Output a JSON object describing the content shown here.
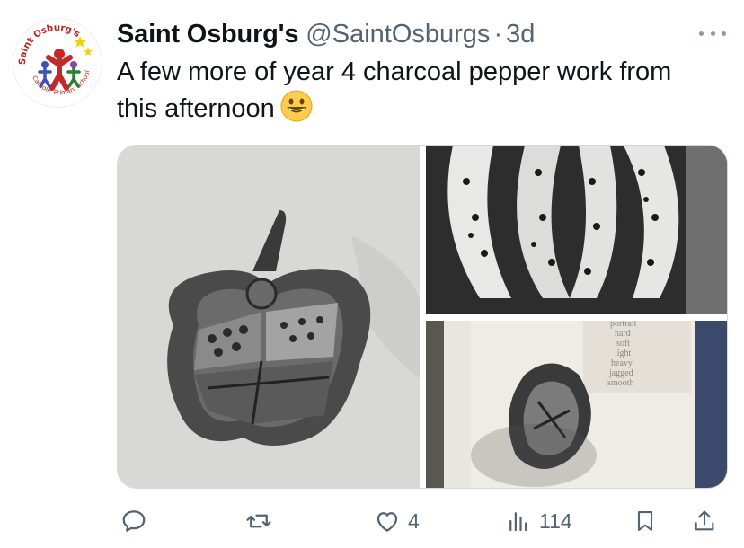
{
  "tweet": {
    "display_name": "Saint Osburg's",
    "handle": "@SaintOsburgs",
    "separator": "·",
    "time": "3d",
    "text": "A few more of year 4 charcoal pepper work from this afternoon",
    "emoji": "grinning-face-emoji"
  },
  "avatar": {
    "name_top": "Saint Osburg's",
    "name_bottom": "Catholic Primary School"
  },
  "media": {
    "images": [
      {
        "desc_icon": "charcoal-pepper-drawing"
      },
      {
        "desc_icon": "charcoal-pepper-closeup"
      },
      {
        "desc_icon": "charcoal-pepper-sketchbook"
      }
    ],
    "sketchbook_words": [
      "portrait",
      "hard",
      "soft",
      "light",
      "heavy",
      "jagged",
      "smooth"
    ]
  },
  "actions": {
    "reply_count": "",
    "retweet_count": "",
    "like_count": "4",
    "views_count": "114"
  },
  "colors": {
    "text": "#0f1419",
    "secondary": "#536471",
    "border": "#cfd9de"
  }
}
